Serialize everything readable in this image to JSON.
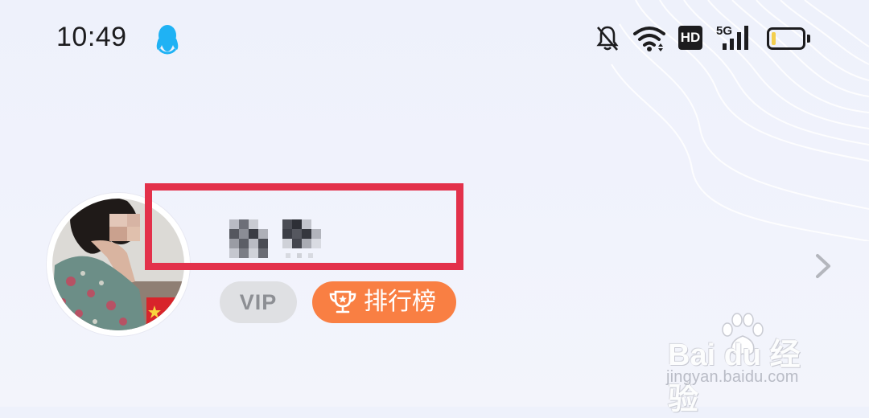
{
  "status_bar": {
    "time": "10:49",
    "icons": [
      "qq-penguin-icon",
      "bell-muted-icon",
      "wifi-icon",
      "hd-icon",
      "signal-5g-icon",
      "battery-icon"
    ],
    "hd_label": "HD",
    "network_label": "5G",
    "battery_level": 0.15
  },
  "profile": {
    "avatar": "user-avatar",
    "name": "",
    "badges": {
      "vip_label": "VIP",
      "rank_label": "排行榜"
    },
    "chevron": "chevron-right-icon"
  },
  "colors": {
    "highlight_border": "#e3314b",
    "rank_button": "#f97f43",
    "vip_badge": "#dfe0e3",
    "accent_qq": "#1fb2f4"
  },
  "watermark": {
    "logo": "Bai du 经验",
    "url": "jingyan.baidu.com"
  }
}
